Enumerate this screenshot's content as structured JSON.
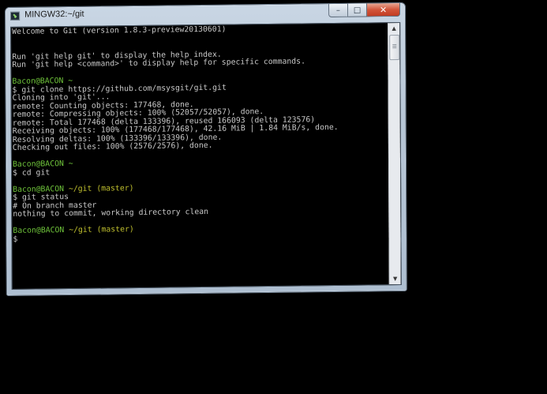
{
  "window": {
    "title": "MINGW32:~/git",
    "buttons": {
      "minimize": "–",
      "maximize": "□",
      "close": "✕"
    }
  },
  "colors": {
    "prompt_user": "#6ec23a",
    "prompt_branch": "#bfbf2e",
    "text": "#c8c8c8",
    "background": "#000000"
  },
  "terminal": {
    "lines": [
      [
        {
          "t": "Welcome to Git (version 1.8.3-preview20130601)"
        }
      ],
      [],
      [],
      [
        {
          "t": "Run 'git help git' to display the help index."
        }
      ],
      [
        {
          "t": "Run 'git help <command>' to display help for specific commands."
        }
      ],
      [],
      [
        {
          "t": "Bacon@BACON ~",
          "c": "green"
        }
      ],
      [
        {
          "t": "$ git clone https://github.com/msysgit/git.git"
        }
      ],
      [
        {
          "t": "Cloning into 'git'..."
        }
      ],
      [
        {
          "t": "remote: Counting objects: 177468, done."
        }
      ],
      [
        {
          "t": "remote: Compressing objects: 100% (52057/52057), done."
        }
      ],
      [
        {
          "t": "remote: Total 177468 (delta 133396), reused 166093 (delta 123576)"
        }
      ],
      [
        {
          "t": "Receiving objects: 100% (177468/177468), 42.16 MiB | 1.84 MiB/s, done."
        }
      ],
      [
        {
          "t": "Resolving deltas: 100% (133396/133396), done."
        }
      ],
      [
        {
          "t": "Checking out files: 100% (2576/2576), done."
        }
      ],
      [],
      [
        {
          "t": "Bacon@BACON ~",
          "c": "green"
        }
      ],
      [
        {
          "t": "$ cd git"
        }
      ],
      [],
      [
        {
          "t": "Bacon@BACON ",
          "c": "green"
        },
        {
          "t": "~/git (master)",
          "c": "yellow"
        }
      ],
      [
        {
          "t": "$ git status"
        }
      ],
      [
        {
          "t": "# On branch master"
        }
      ],
      [
        {
          "t": "nothing to commit, working directory clean"
        }
      ],
      [],
      [
        {
          "t": "Bacon@BACON ",
          "c": "green"
        },
        {
          "t": "~/git (master)",
          "c": "yellow"
        }
      ],
      [
        {
          "t": "$"
        }
      ]
    ]
  },
  "scrollbar": {
    "up": "▲",
    "down": "▼"
  }
}
